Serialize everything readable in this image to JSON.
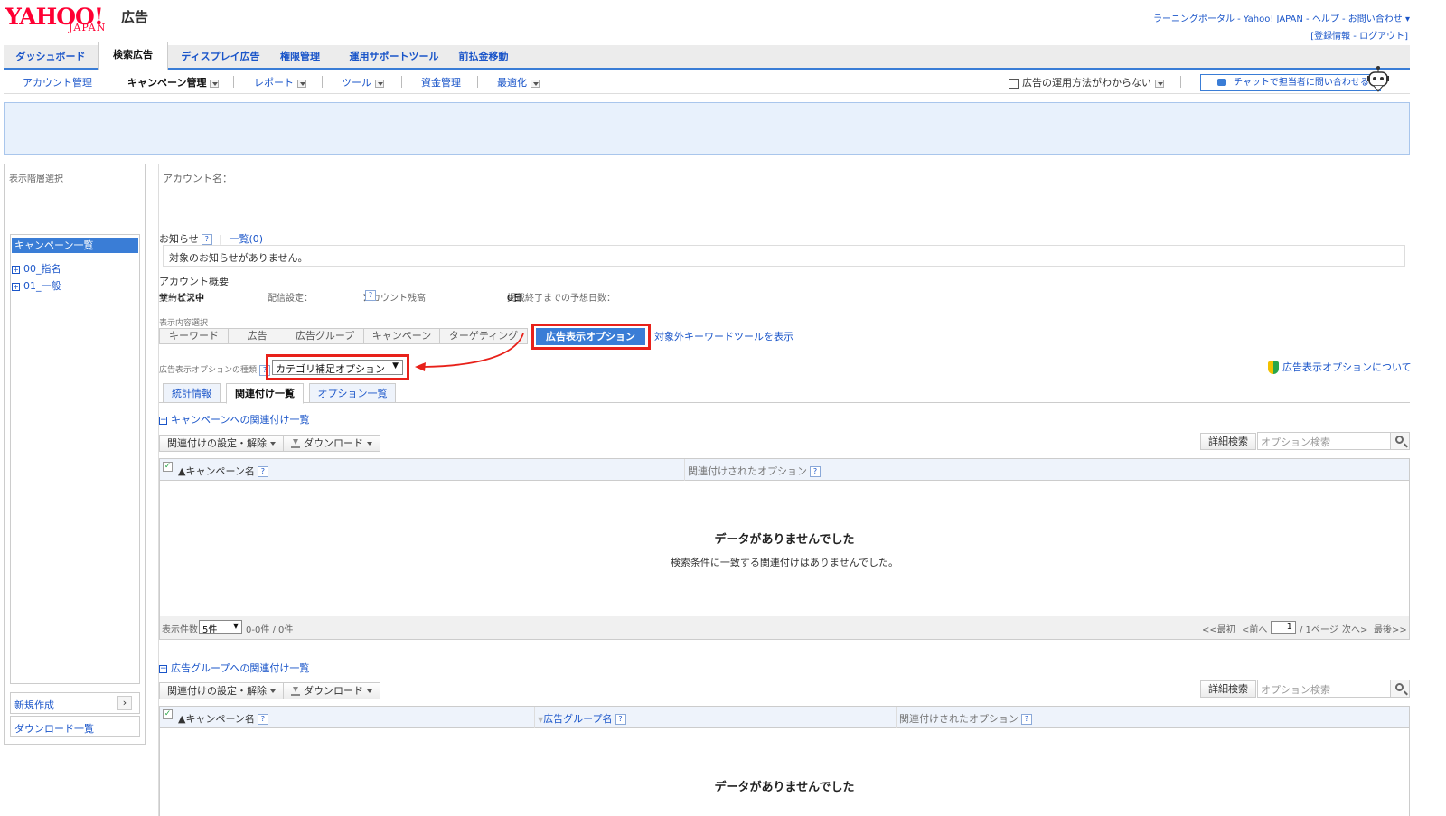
{
  "logo": {
    "yahoo": "YAHOO!",
    "japan": "JAPAN",
    "ad": "広告"
  },
  "header": {
    "links_line1": "ラーニングポータル - Yahoo! JAPAN - ヘルプ - お問い合わせ ▾",
    "links_line2": "[登録情報 - ログアウト]"
  },
  "main_tabs": [
    {
      "label": "ダッシュボード"
    },
    {
      "label": "検索広告"
    },
    {
      "label": "ディスプレイ広告"
    },
    {
      "label": "権限管理"
    },
    {
      "label": "運用サポートツール"
    },
    {
      "label": "前払金移動"
    }
  ],
  "sub_nav": {
    "account": "アカウント管理",
    "campaign": "キャンペーン管理",
    "report": "レポート",
    "tool": "ツール",
    "funds": "資金管理",
    "optimize": "最適化",
    "help_dropdown": "広告の運用方法がわからない",
    "chat_button": "チャットで担当者に問い合わせる"
  },
  "sidebar": {
    "title": "表示階層選択",
    "selected": "キャンペーン一覧",
    "items": [
      {
        "label": "00_指名"
      },
      {
        "label": "01_一般"
      }
    ],
    "new": "新規作成",
    "download_list": "ダウンロード一覧"
  },
  "account": {
    "name_label": "アカウント名："
  },
  "notice": {
    "label": "お知らせ",
    "list_link": "一覧(0)",
    "message": "対象のお知らせがありません。"
  },
  "overview": {
    "label": "アカウント概要",
    "contract_label": "契約状況：",
    "contract_value": "サービス中",
    "delivery_label": "配信設定：",
    "balance_label": "アカウント残高",
    "balance_colon": "：",
    "days_label": "掲載終了までの予想日数：",
    "days_value": "0日"
  },
  "display": {
    "label": "表示内容選択",
    "segments": [
      "キーワード",
      "広告",
      "広告グループ",
      "キャンペーン",
      "ターゲティング"
    ],
    "active_segment": "広告表示オプション",
    "kw_tool_link": "対象外キーワードツールを表示"
  },
  "option_type": {
    "label": "広告表示オプションの種類",
    "selected": "カテゴリ補足オプション",
    "about_link": "広告表示オプションについて"
  },
  "sub_tabs": [
    {
      "label": "統計情報"
    },
    {
      "label": "関連付け一覧"
    },
    {
      "label": "オプション一覧"
    }
  ],
  "section1": {
    "title": "キャンペーンへの関連付け一覧",
    "assoc_btn": "関連付けの設定・解除",
    "download_btn": "ダウンロード",
    "adv_search_btn": "詳細検索",
    "search_placeholder": "オプション検索",
    "col_campaign": "▲キャンペーン名",
    "col_options": "関連付けされたオプション",
    "nodata_title": "データがありませんでした",
    "nodata_sub": "検索条件に一致する関連付けはありませんでした。"
  },
  "pager": {
    "count_label": "表示件数",
    "page_size": "5件",
    "range": "0-0件 / 0件",
    "first": "<<最初",
    "prev": "<前へ",
    "page": "1",
    "of_pages": "/ 1ページ",
    "next": "次へ>",
    "last": "最後>>"
  },
  "section2": {
    "title": "広告グループへの関連付け一覧",
    "assoc_btn": "関連付けの設定・解除",
    "download_btn": "ダウンロード",
    "adv_search_btn": "詳細検索",
    "search_placeholder": "オプション検索",
    "col_campaign": "▲キャンペーン名",
    "col_adgroup": "広告グループ名",
    "col_options": "関連付けされたオプション",
    "nodata_title": "データがありませんでした"
  },
  "colors": {
    "accent": "#3a7dd6",
    "link": "#1a55c9",
    "highlight": "#e8211a",
    "brand": "#ff0033"
  }
}
